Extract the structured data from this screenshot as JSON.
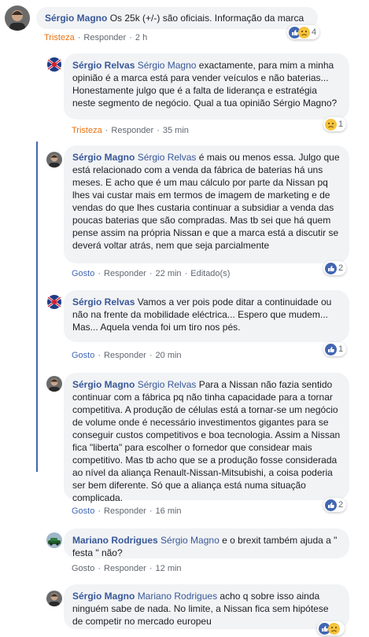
{
  "colors": {
    "link": "#385898",
    "sad": "#e9710f",
    "like": "#4267b2",
    "bubble": "#f2f3f5",
    "meta": "#606770"
  },
  "comments": [
    {
      "author": "Sérgio Magno",
      "mention": "",
      "text": "Os 25k (+/-) são oficiais. Informação da marca",
      "reaction_label": "Tristeza",
      "reply_label": "Responder",
      "time": "2 h",
      "edited": "",
      "reaction_icons": [
        "like-icon",
        "sad-icon"
      ],
      "reaction_count": "4"
    },
    {
      "author": "Sérgio Relvas",
      "mention": "Sérgio Magno",
      "text": "exactamente, para mim a minha opinião é a marca está para vender veículos e não baterias... Honestamente julgo que é a falta de liderança e estratégia neste segmento de negócio. Qual a tua opinião Sérgio Magno?",
      "reaction_label": "Tristeza",
      "reply_label": "Responder",
      "time": "35 min",
      "edited": "",
      "reaction_icons": [
        "sad-icon"
      ],
      "reaction_count": "1"
    },
    {
      "author": "Sérgio Magno",
      "mention": "Sérgio Relvas",
      "text": "é mais ou menos essa. Julgo que está relacionado com a venda da fábrica de baterias há uns meses. E acho que é um mau cálculo por parte da Nissan pq lhes vai custar mais em termos de imagem de marketing e de vendas do que lhes custaria continuar a subsidiar a venda das poucas baterias que são compradas. Mas tb sei que há quem pense assim na própria Nissan e que a marca está a discutir se deverá voltar atrás, nem que seja parcialmente",
      "reaction_label": "Gosto",
      "reply_label": "Responder",
      "time": "22 min",
      "edited": "Editado(s)",
      "reaction_icons": [
        "like-icon"
      ],
      "reaction_count": "2"
    },
    {
      "author": "Sérgio Relvas",
      "mention": "",
      "text": "Vamos a ver pois pode ditar a continuidade ou não na frente da mobilidade eléctrica... Espero que mudem... Mas... Aquela venda foi um tiro nos pés.",
      "reaction_label": "Gosto",
      "reply_label": "Responder",
      "time": "20 min",
      "edited": "",
      "reaction_icons": [
        "like-icon"
      ],
      "reaction_count": "1"
    },
    {
      "author": "Sérgio Magno",
      "mention": "Sérgio Relvas",
      "text": "Para a Nissan não fazia sentido continuar com a fábrica pq não tinha capacidade para a tornar competitiva. A produção de células está a tornar-se um negócio de volume onde é necessário investimentos gigantes para se conseguir custos competitivos e boa tecnologia. Assim a Nissan fica \"liberta\" para escolher o fornedor que considear mais competitivo. Mas tb acho que se a produção fosse considerada ao nível da aliança Renault-Nissan-Mitsubishi, a coisa poderia ser bem diferente. Só que a aliança está numa situação complicada.",
      "reaction_label": "Gosto",
      "reply_label": "Responder",
      "time": "16 min",
      "edited": "",
      "reaction_icons": [
        "like-icon"
      ],
      "reaction_count": "2"
    },
    {
      "author": "Mariano Rodrigues",
      "mention": "Sérgio Magno",
      "text": "e o brexit também ajuda a \" festa \" não?",
      "reaction_label": "Gosto",
      "reply_label": "Responder",
      "time": "12 min",
      "edited": "",
      "reaction_icons": [],
      "reaction_count": ""
    },
    {
      "author": "Sérgio Magno",
      "mention": "Mariano Rodrigues",
      "text": "acho q sobre isso ainda ninguém sabe de nada. No limite, a Nissan fica sem hipótese de competir no mercado europeu",
      "reaction_label": "",
      "reply_label": "",
      "time": "",
      "edited": "",
      "reaction_icons": [
        "like-icon",
        "sad-icon"
      ],
      "reaction_count": ""
    }
  ]
}
